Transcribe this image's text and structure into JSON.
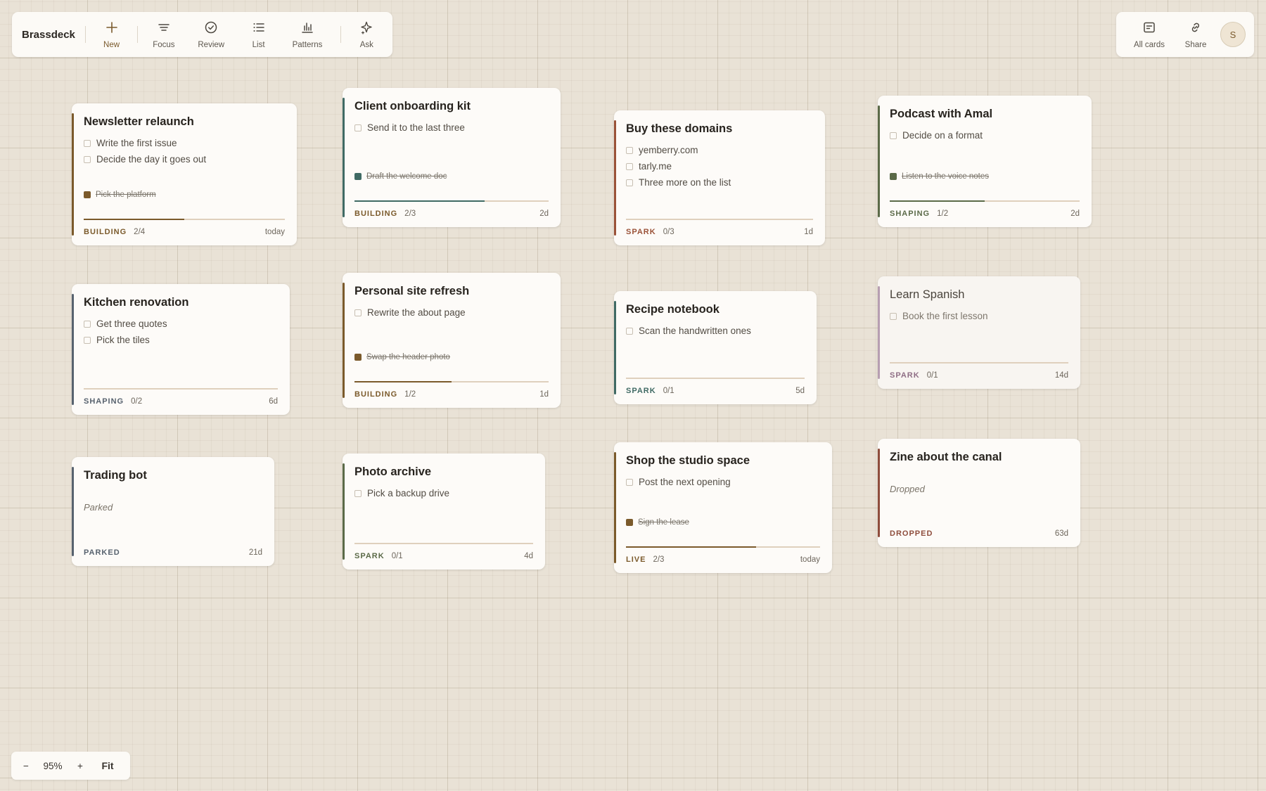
{
  "toolbar": {
    "brand": "Brassdeck",
    "buttons": [
      {
        "label": "New",
        "icon": "plus-icon"
      },
      {
        "label": "Focus",
        "icon": "focus-lines-icon"
      },
      {
        "label": "Review",
        "icon": "check-circle-icon"
      },
      {
        "label": "List",
        "icon": "list-icon"
      },
      {
        "label": "Patterns",
        "icon": "bar-chart-icon"
      },
      {
        "label": "Ask",
        "icon": "sparkle-icon"
      }
    ]
  },
  "topright": {
    "all_cards": "All cards",
    "share": "Share",
    "avatar_initial": "S"
  },
  "colors": {
    "building": "#7b5a2b",
    "shaping": "#5b6a48",
    "spark": "#9a5238",
    "teal": "#406a64",
    "slate": "#57626e",
    "mauve": "#8f6e85",
    "dropped": "#8e4d3c"
  },
  "cards": [
    {
      "title": "Newsletter relaunch",
      "tasks": [
        "Write the first issue",
        "Decide the day it goes out"
      ],
      "done": "Pick the platform",
      "status": "BUILDING",
      "count": "2/4",
      "age": "today",
      "progress": 0.5
    },
    {
      "title": "Client onboarding kit",
      "tasks": [
        "Send it to the last three"
      ],
      "done": "Draft the welcome doc",
      "status": "BUILDING",
      "count": "2/3",
      "age": "2d",
      "progress": 0.67
    },
    {
      "title": "Buy these domains",
      "tasks": [
        "yemberry.com",
        "tarly.me",
        "Three more on the list"
      ],
      "status": "SPARK",
      "count": "0/3",
      "age": "1d",
      "progress": 0
    },
    {
      "title": "Podcast with Amal",
      "tasks": [
        "Decide on a format"
      ],
      "done": "Listen to the voice notes",
      "status": "SHAPING",
      "count": "1/2",
      "age": "2d",
      "progress": 0.5
    },
    {
      "title": "Kitchen renovation",
      "tasks": [
        "Get three quotes",
        "Pick the tiles"
      ],
      "status": "SHAPING",
      "count": "0/2",
      "age": "6d",
      "progress": 0
    },
    {
      "title": "Personal site refresh",
      "tasks": [
        "Rewrite the about page"
      ],
      "done": "Swap the header photo",
      "status": "BUILDING",
      "count": "1/2",
      "age": "1d",
      "progress": 0.5
    },
    {
      "title": "Recipe notebook",
      "tasks": [
        "Scan the handwritten ones"
      ],
      "status": "SPARK",
      "count": "0/1",
      "age": "5d",
      "progress": 0
    },
    {
      "title": "Learn Spanish",
      "tasks": [
        "Book the first lesson"
      ],
      "status": "SPARK",
      "count": "0/1",
      "age": "14d",
      "progress": 0
    },
    {
      "title": "Trading bot",
      "note": "Parked",
      "status": "PARKED",
      "age": "21d"
    },
    {
      "title": "Photo archive",
      "tasks": [
        "Pick a backup drive"
      ],
      "status": "SPARK",
      "count": "0/1",
      "age": "4d",
      "progress": 0
    },
    {
      "title": "Shop the studio space",
      "tasks": [
        "Post the next opening"
      ],
      "done": "Sign the lease",
      "status": "LIVE",
      "count": "2/3",
      "age": "today",
      "progress": 0.67
    },
    {
      "title": "Zine about the canal",
      "note": "Dropped",
      "status": "DROPPED",
      "age": "63d"
    }
  ],
  "zoom": {
    "minus": "−",
    "level": "95%",
    "plus": "+",
    "fit": "Fit"
  }
}
